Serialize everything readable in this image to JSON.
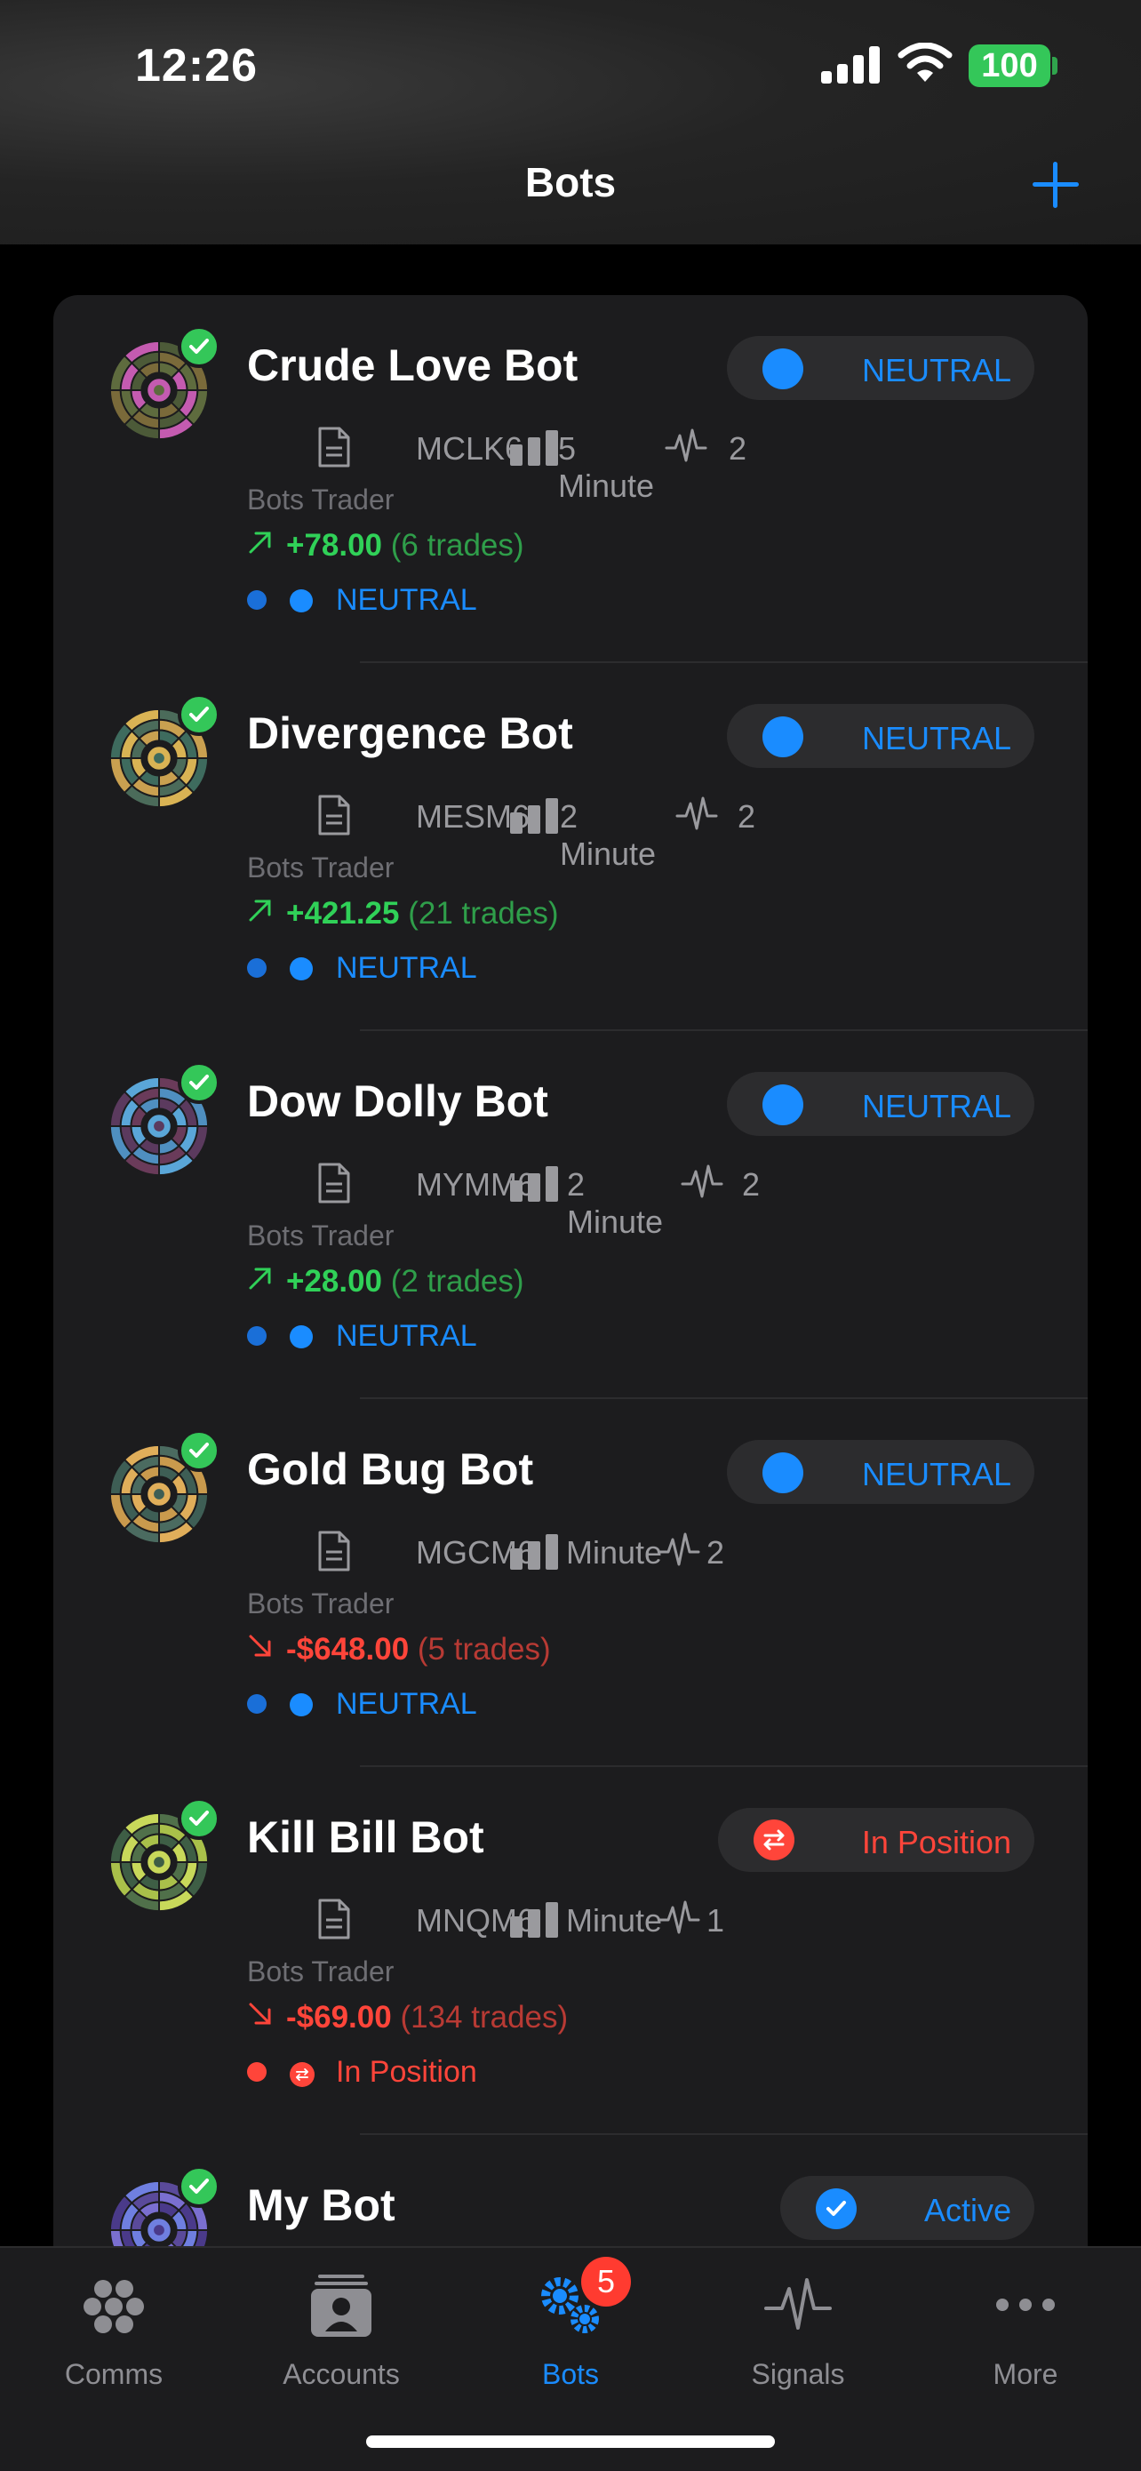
{
  "status": {
    "time": "12:26",
    "battery": "100"
  },
  "nav": {
    "title": "Bots"
  },
  "bots": [
    {
      "name": "Crude Love Bot",
      "pill": "NEUTRAL",
      "pill_kind": "neutral",
      "symbol": "MCLK6",
      "interval": "5 Minute",
      "signals": "2",
      "trader": "Bots Trader",
      "pnl": "+78.00",
      "trades": "(6 trades)",
      "dir": "up",
      "state": "NEUTRAL",
      "state_kind": "neutral",
      "colors": [
        "#5e6b3e",
        "#c45bb0",
        "#4c5a38",
        "#7a6a3a"
      ]
    },
    {
      "name": "Divergence Bot",
      "pill": "NEUTRAL",
      "pill_kind": "neutral",
      "symbol": "MESM6",
      "interval": "2 Minute",
      "signals": "2",
      "trader": "Bots Trader",
      "pnl": "+421.25",
      "trades": "(21 trades)",
      "dir": "up",
      "state": "NEUTRAL",
      "state_kind": "neutral",
      "colors": [
        "#3e6b5e",
        "#d9b354",
        "#4b6b5a",
        "#c9a050"
      ]
    },
    {
      "name": "Dow Dolly Bot",
      "pill": "NEUTRAL",
      "pill_kind": "neutral",
      "symbol": "MYMM6",
      "interval": "2 Minute",
      "signals": "2",
      "trader": "Bots Trader",
      "pnl": "+28.00",
      "trades": "(2 trades)",
      "dir": "up",
      "state": "NEUTRAL",
      "state_kind": "neutral",
      "colors": [
        "#5b3a5e",
        "#5aa6d8",
        "#6a3b5a",
        "#4f8fc0"
      ]
    },
    {
      "name": "Gold Bug Bot",
      "pill": "NEUTRAL",
      "pill_kind": "neutral",
      "symbol": "MGCM6",
      "interval": "Minute",
      "signals": "2",
      "trader": "Bots Trader",
      "pnl": "-$648.00",
      "trades": "(5 trades)",
      "dir": "down",
      "state": "NEUTRAL",
      "state_kind": "neutral",
      "colors": [
        "#3e5e55",
        "#e0ae5a",
        "#4b6b60",
        "#c99a4d"
      ]
    },
    {
      "name": "Kill Bill Bot",
      "pill": "In Position",
      "pill_kind": "position",
      "symbol": "MNQM6",
      "interval": "Minute",
      "signals": "1",
      "trader": "Bots Trader",
      "pnl": "-$69.00",
      "trades": "(134 trades)",
      "dir": "down",
      "state": "In Position",
      "state_kind": "position",
      "colors": [
        "#3e5e45",
        "#c8d85a",
        "#50704a",
        "#a9c04a"
      ]
    },
    {
      "name": "My Bot",
      "pill": "Active",
      "pill_kind": "active",
      "symbol": "",
      "interval": "",
      "signals": "",
      "trader": "",
      "pnl": "",
      "trades": "",
      "dir": "",
      "state": "",
      "state_kind": "",
      "colors": [
        "#4a3a8a",
        "#6f7fe0",
        "#5a4a9a",
        "#7a6fd0"
      ]
    }
  ],
  "tabs": [
    {
      "label": "Comms",
      "icon": "comms-icon"
    },
    {
      "label": "Accounts",
      "icon": "accounts-icon"
    },
    {
      "label": "Bots",
      "icon": "gears-icon",
      "badge": "5",
      "active": true
    },
    {
      "label": "Signals",
      "icon": "pulse-icon"
    },
    {
      "label": "More",
      "icon": "ellipsis-icon"
    }
  ],
  "accent": "#1a8cff"
}
